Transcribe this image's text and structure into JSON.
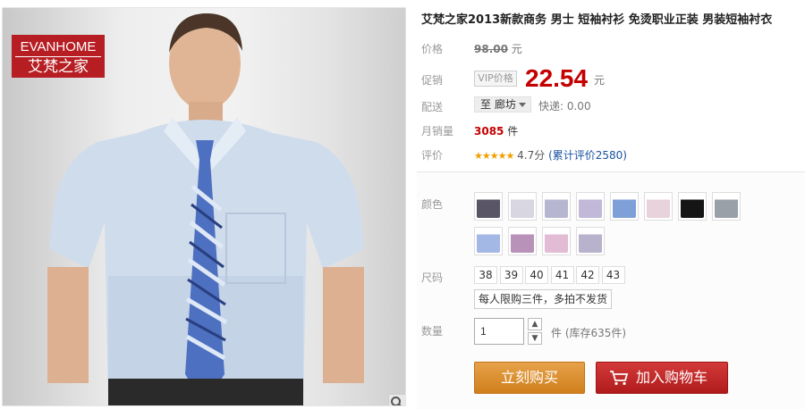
{
  "brand": {
    "en": "EVANHOME",
    "cn": "艾梵之家"
  },
  "product": {
    "title": "艾梵之家2013新款商务 男士 短袖衬衫 免烫职业正装 男装短袖衬衣"
  },
  "labels": {
    "price": "价格",
    "promo": "促销",
    "shipping": "配送",
    "monthly_sales": "月销量",
    "review": "评价",
    "color": "颜色",
    "size": "尺码",
    "quantity": "数量"
  },
  "price": {
    "original": "98.00",
    "original_unit": "元",
    "vip_tag": "VIP价格",
    "promo": "22.54",
    "promo_unit": "元"
  },
  "shipping": {
    "destination": "至 廊坊",
    "express": "快递: 0.00"
  },
  "sales": {
    "count": "3085",
    "unit": "件"
  },
  "rating": {
    "stars": "★★★★★",
    "score": "4.7分",
    "link": "(累计评价2580)"
  },
  "colors": {
    "swatches": [
      "#5a5566",
      "#d8d6e0",
      "#b6b6d0",
      "#c2b8d8",
      "#7e9fd8",
      "#e8d2dc",
      "#151515",
      "#9aa0a8",
      "#a4b8e6",
      "#b892b8",
      "#e2bcd4",
      "#b8b2cc"
    ]
  },
  "sizes": [
    "38",
    "39",
    "40",
    "41",
    "42",
    "43"
  ],
  "limit_note": "每人限购三件，多拍不发货",
  "quantity": {
    "value": "1",
    "up": "▲",
    "down": "▼",
    "stock": "件 (库存635件)"
  },
  "buttons": {
    "buy_now": "立刻购买",
    "add_to_cart": "加入购物车"
  }
}
